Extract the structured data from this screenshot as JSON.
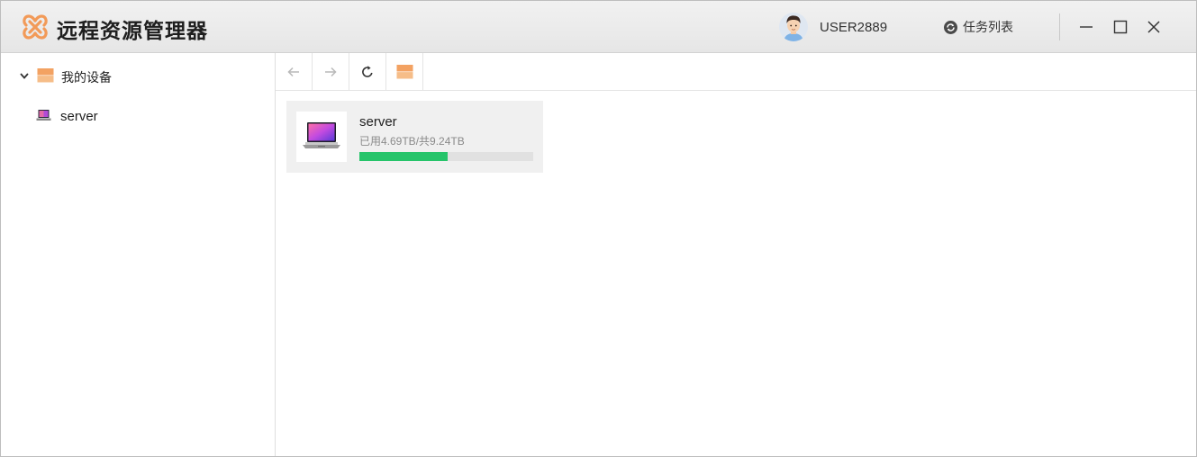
{
  "app": {
    "title": "远程资源管理器",
    "brand_color": "#f29a58"
  },
  "header": {
    "username": "USER2889",
    "task_list_label": "任务列表"
  },
  "sidebar": {
    "root_label": "我的设备",
    "items": [
      {
        "label": "server",
        "icon": "laptop-icon"
      }
    ]
  },
  "toolbar": {
    "buttons": [
      "back-icon",
      "forward-icon",
      "refresh-icon",
      "home-folder-icon"
    ]
  },
  "devices": [
    {
      "name": "server",
      "usage_text": "已用4.69TB/共9.24TB",
      "used_fraction": 0.508,
      "bar_color": "#26c46a"
    }
  ]
}
